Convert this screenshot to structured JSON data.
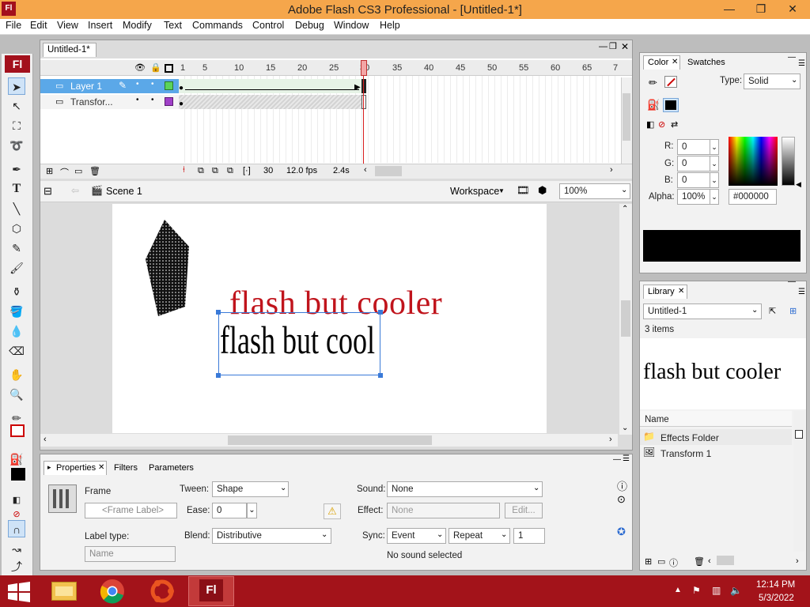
{
  "window": {
    "title": "Adobe Flash CS3 Professional - [Untitled-1*]",
    "app_icon": "Fl",
    "controls": {
      "minimize": "—",
      "restore": "❐",
      "close": "✕"
    }
  },
  "menu": [
    "File",
    "Edit",
    "View",
    "Insert",
    "Modify",
    "Text",
    "Commands",
    "Control",
    "Debug",
    "Window",
    "Help"
  ],
  "toolbar": {
    "badge": "Fl"
  },
  "document": {
    "tab_label": "Untitled-1*",
    "timeline": {
      "frame_numbers": [
        "1",
        "5",
        "10",
        "15",
        "20",
        "25",
        "30",
        "35",
        "40",
        "45",
        "50",
        "55",
        "60",
        "65",
        "7"
      ],
      "layers": [
        {
          "name": "Layer 1",
          "color": "#5bd35b"
        },
        {
          "name": "Transfor...",
          "color": "#a040c8"
        }
      ],
      "current_frame": "30",
      "fps": "12.0 fps",
      "elapsed": "2.4s"
    },
    "edit_bar": {
      "scene": "Scene 1",
      "workspace": "Workspace",
      "zoom": "100%"
    },
    "stage": {
      "red_text": "flash but cooler",
      "black_text": "flash but cool",
      "red_color": "#c0141c"
    }
  },
  "properties": {
    "tabs": [
      "Properties",
      "Filters",
      "Parameters"
    ],
    "frame_label": "Frame",
    "frame_label_placeholder": "<Frame Label>",
    "label_type_label": "Label type:",
    "label_type_value": "Name",
    "tween_label": "Tween:",
    "tween_value": "Shape",
    "ease_label": "Ease:",
    "ease_value": "0",
    "blend_label": "Blend:",
    "blend_value": "Distributive",
    "sound_label": "Sound:",
    "sound_value": "None",
    "effect_label": "Effect:",
    "effect_value": "None",
    "edit_button": "Edit...",
    "sync_label": "Sync:",
    "sync_value": "Event",
    "repeat_value": "Repeat",
    "repeat_count": "1",
    "no_sound": "No sound selected"
  },
  "color_panel": {
    "tabs": [
      "Color",
      "Swatches"
    ],
    "type_label": "Type:",
    "type_value": "Solid",
    "r_label": "R:",
    "r_value": "0",
    "g_label": "G:",
    "g_value": "0",
    "b_label": "B:",
    "b_value": "0",
    "alpha_label": "Alpha:",
    "alpha_value": "100%",
    "hex_value": "#000000",
    "preview_color": "#000000"
  },
  "library": {
    "tab": "Library",
    "document": "Untitled-1",
    "count": "3 items",
    "preview_text": "flash but cooler",
    "column_name": "Name",
    "items": [
      "Effects Folder",
      "Transform 1"
    ]
  },
  "taskbar": {
    "time": "12:14 PM",
    "date": "5/3/2022",
    "active_app_label": "Fl"
  }
}
